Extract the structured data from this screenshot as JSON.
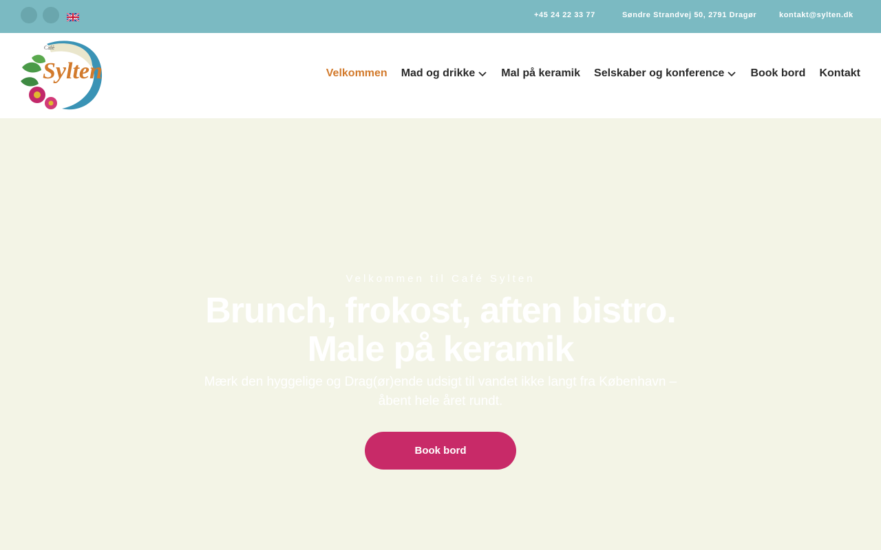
{
  "topbar": {
    "phone": "+45 24 22 33 77",
    "address": "Søndre Strandvej 50, 2791 Dragør",
    "email": "kontakt@sylten.dk",
    "social_icons": [
      "social-icon",
      "social-icon"
    ],
    "language_flag": "uk-flag-icon"
  },
  "logo": {
    "small_text": "Café",
    "name": "Sylten"
  },
  "nav": {
    "items": [
      {
        "label": "Velkommen",
        "active": true
      },
      {
        "label": "Mad og drikke",
        "has_dropdown": true
      },
      {
        "label": "Mal på keramik"
      },
      {
        "label": "Selskaber og konference",
        "has_dropdown": true
      },
      {
        "label": "Book bord"
      },
      {
        "label": "Kontakt"
      }
    ]
  },
  "hero": {
    "eyebrow": "Velkommen til Café Sylten",
    "title_line1": "Brunch, frokost, aften bistro.",
    "title_line2": "Male på keramik",
    "subtitle_line1": "Mærk den hyggelige og Drag(ør)ende udsigt til vandet ikke langt fra København –",
    "subtitle_line2": "åbent hele året rundt.",
    "cta_label": "Book bord"
  },
  "colors": {
    "topbar": "#7bbac2",
    "active_nav": "#d27a2c",
    "hero_bg": "#f3f4e6",
    "cta": "#c82a68"
  }
}
